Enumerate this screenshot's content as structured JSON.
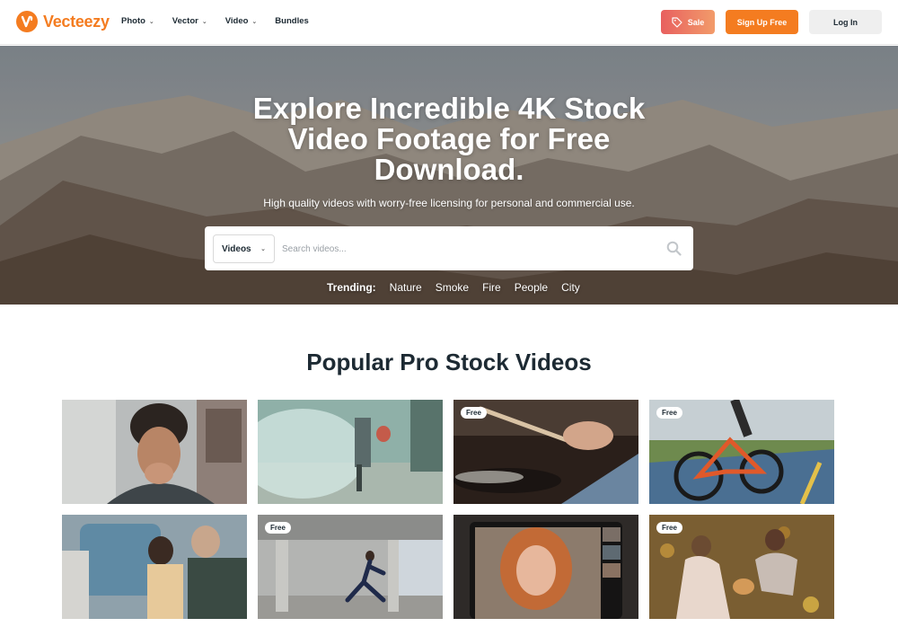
{
  "header": {
    "logo_text": "Vecteezy",
    "nav": [
      {
        "label": "Photo",
        "dropdown": true
      },
      {
        "label": "Vector",
        "dropdown": true
      },
      {
        "label": "Video",
        "dropdown": true
      },
      {
        "label": "Bundles",
        "dropdown": false
      }
    ],
    "sale_label": "Sale",
    "signup_label": "Sign Up Free",
    "login_label": "Log In"
  },
  "hero": {
    "title": "Explore Incredible 4K Stock Video Footage for Free Download.",
    "subtitle": "High quality videos with worry-free licensing for personal and commercial use.",
    "search": {
      "type_selected": "Videos",
      "placeholder": "Search videos..."
    },
    "trending": {
      "label": "Trending:",
      "links": [
        "Nature",
        "Smoke",
        "Fire",
        "People",
        "City"
      ]
    }
  },
  "section": {
    "title": "Popular Pro Stock Videos",
    "badge_label": "Free",
    "videos": [
      {
        "subject": "man-hands-covering-mouth",
        "free": false
      },
      {
        "subject": "person-in-sunlit-park",
        "free": false
      },
      {
        "subject": "drummer-playing-drums",
        "free": true
      },
      {
        "subject": "cyclist-on-road",
        "free": true
      },
      {
        "subject": "family-on-couch",
        "free": false
      },
      {
        "subject": "man-stretching-under-bridge",
        "free": true
      },
      {
        "subject": "woman-video-call",
        "free": false
      },
      {
        "subject": "couple-in-autumn-leaves",
        "free": true
      }
    ]
  },
  "colors": {
    "brand_orange": "#f47c20",
    "sale_gradient_start": "#e8605f",
    "sale_gradient_end": "#f29b6a",
    "dark_text": "#1d2a33"
  }
}
